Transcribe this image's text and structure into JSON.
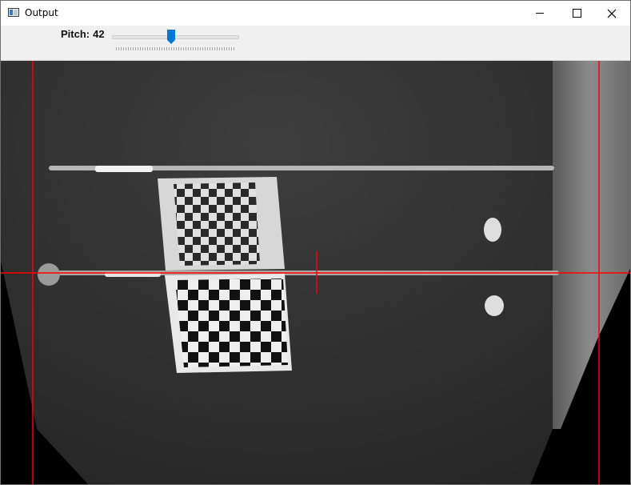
{
  "window": {
    "title": "Output",
    "icon": "window-app-icon"
  },
  "titlebar_buttons": [
    "minimize-icon",
    "maximize-icon",
    "close-icon"
  ],
  "trackbar": {
    "label": "Pitch:",
    "value": "42",
    "fraction": 0.42
  },
  "colors": {
    "crosshair": "#ff0000",
    "slider_thumb": "#0078d7"
  }
}
